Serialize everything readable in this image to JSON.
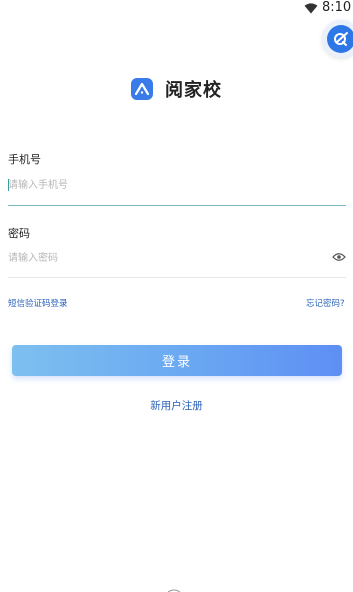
{
  "status_bar": {
    "time": "8:10",
    "wifi_icon": "wifi-icon"
  },
  "assist_button": {
    "icon": "assist-icon"
  },
  "brand": {
    "name": "阅家校",
    "logo_icon": "app-logo-icon",
    "logo_color": "#3a7bea"
  },
  "form": {
    "phone": {
      "label": "手机号",
      "placeholder": "请输入手机号",
      "value": ""
    },
    "password": {
      "label": "密码",
      "placeholder": "请输入密码",
      "value": "",
      "toggle_icon": "eye-icon"
    },
    "sms_login_link": "短信验证码登录",
    "forgot_password_link": "忘记密码?",
    "login_button": "登录",
    "register_link": "新用户注册"
  },
  "colors": {
    "accent": "#2c63b8",
    "button_gradient_start": "#7dc0ef",
    "button_gradient_end": "#5e8ff4",
    "active_underline": "#7bb8bd"
  }
}
